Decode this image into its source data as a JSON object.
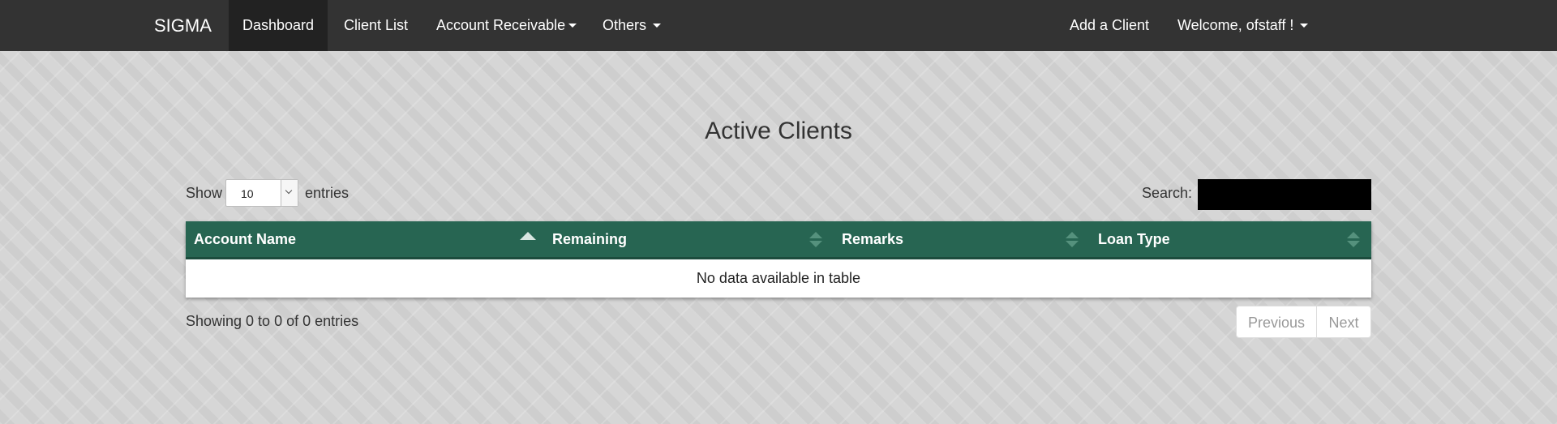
{
  "navbar": {
    "brand": "SIGMA",
    "items": [
      {
        "label": "Dashboard"
      },
      {
        "label": "Client List"
      },
      {
        "label": "Account Receivable"
      },
      {
        "label": "Others"
      }
    ],
    "right_items": [
      {
        "label": "Add a Client"
      },
      {
        "label": "Welcome, ofstaff !"
      }
    ]
  },
  "page": {
    "title": "Active Clients"
  },
  "length_control": {
    "prefix": "Show",
    "selected": "10",
    "suffix": "entries"
  },
  "search": {
    "label": "Search:",
    "value": ""
  },
  "table": {
    "columns": [
      {
        "label": "Account Name",
        "sort": "ascending"
      },
      {
        "label": "Remaining",
        "sort": "none"
      },
      {
        "label": "Remarks",
        "sort": "none"
      },
      {
        "label": "Loan Type",
        "sort": "none"
      }
    ],
    "empty_message": "No data available in table"
  },
  "footer": {
    "info": "Showing 0 to 0 of 0 entries",
    "previous": "Previous",
    "next": "Next"
  },
  "colors": {
    "navbar": "#333333",
    "navbar_active": "#222222",
    "table_header": "#276552"
  }
}
